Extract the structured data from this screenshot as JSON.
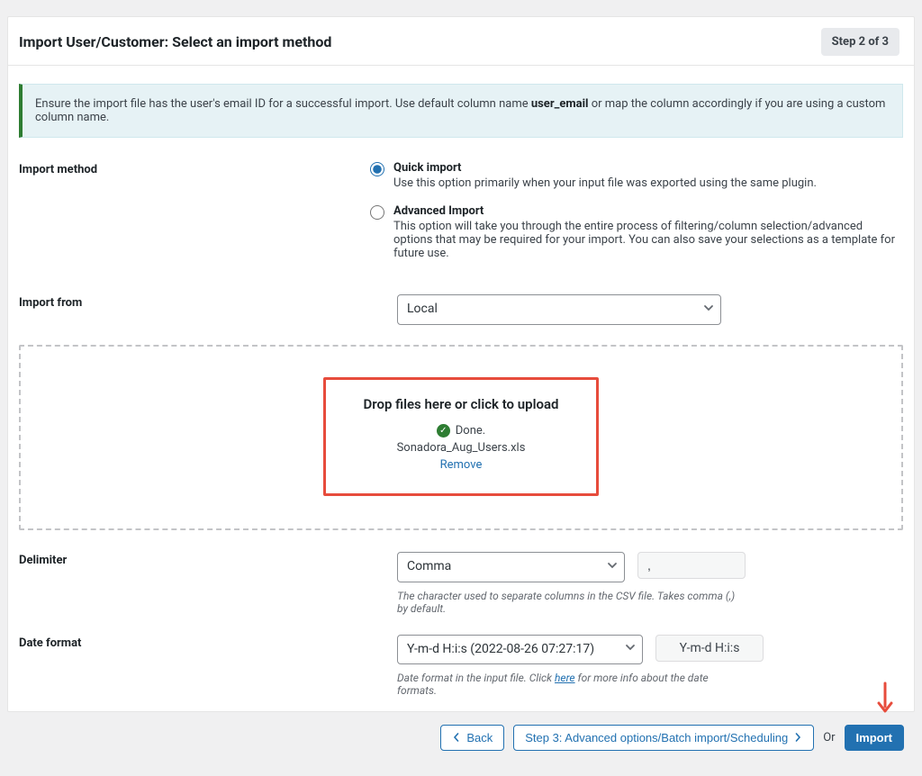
{
  "header": {
    "title": "Import User/Customer: Select an import method",
    "step_badge": "Step 2 of 3"
  },
  "banner": {
    "prefix": "Ensure the import file has the user's email ID for a successful import. Use default column name ",
    "bold": "user_email",
    "suffix": " or map the column accordingly if you are using a custom column name."
  },
  "import_method": {
    "label": "Import method",
    "quick": {
      "title": "Quick import",
      "desc": "Use this option primarily when your input file was exported using the same plugin."
    },
    "advanced": {
      "title": "Advanced Import",
      "desc": "This option will take you through the entire process of filtering/column selection/advanced options that may be required for your import. You can also save your selections as a template for future use."
    }
  },
  "import_from": {
    "label": "Import from",
    "selected": "Local"
  },
  "dropzone": {
    "title": "Drop files here or click to upload",
    "done": "Done.",
    "filename": "Sonadora_Aug_Users.xls",
    "remove": "Remove"
  },
  "delimiter": {
    "label": "Delimiter",
    "selected": "Comma",
    "value": ",",
    "help": "The character used to separate columns in the CSV file. Takes comma (,) by default."
  },
  "date_format": {
    "label": "Date format",
    "selected": "Y-m-d H:i:s (2022-08-26 07:27:17)",
    "sample": "Y-m-d H:i:s",
    "help_prefix": "Date format in the input file. Click ",
    "help_link": "here",
    "help_suffix": " for more info about the date formats."
  },
  "footer": {
    "back": "Back",
    "step3": "Step 3: Advanced options/Batch import/Scheduling",
    "or": "Or",
    "import": "Import"
  }
}
